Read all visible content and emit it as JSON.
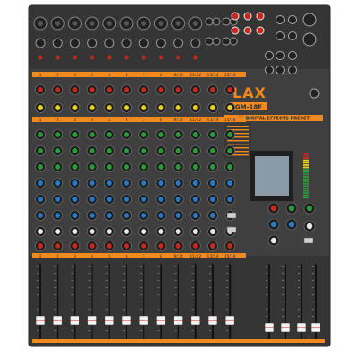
{
  "brand": {
    "logo_text": "LAX",
    "model": "GM-18F"
  },
  "fx_section": {
    "title": "99 DIGITAL EFFECTS PRESET"
  },
  "channels": {
    "labels": [
      "1",
      "2",
      "3",
      "4",
      "5",
      "6",
      "7",
      "8",
      "9/10",
      "11/12",
      "13/14",
      "15/16"
    ]
  },
  "colors": {
    "panel": "#3f3f3f",
    "panel_dark": "#2e2e2e",
    "accent_orange": "#f08a1c",
    "knob_red": "#c8281e",
    "knob_yellow": "#e8d21a",
    "knob_green": "#2a9a3a",
    "knob_blue": "#2a79c8",
    "knob_white": "#e8e8e8",
    "lcd_screen": "#8a9aa6",
    "fader_cap": "#f2f2f2"
  },
  "icons": [
    "xlr-input-icon",
    "trs-jack-icon",
    "rca-jack-icon",
    "knob-icon",
    "button-icon",
    "fader-icon",
    "lcd-screen-icon",
    "led-meter-icon"
  ]
}
